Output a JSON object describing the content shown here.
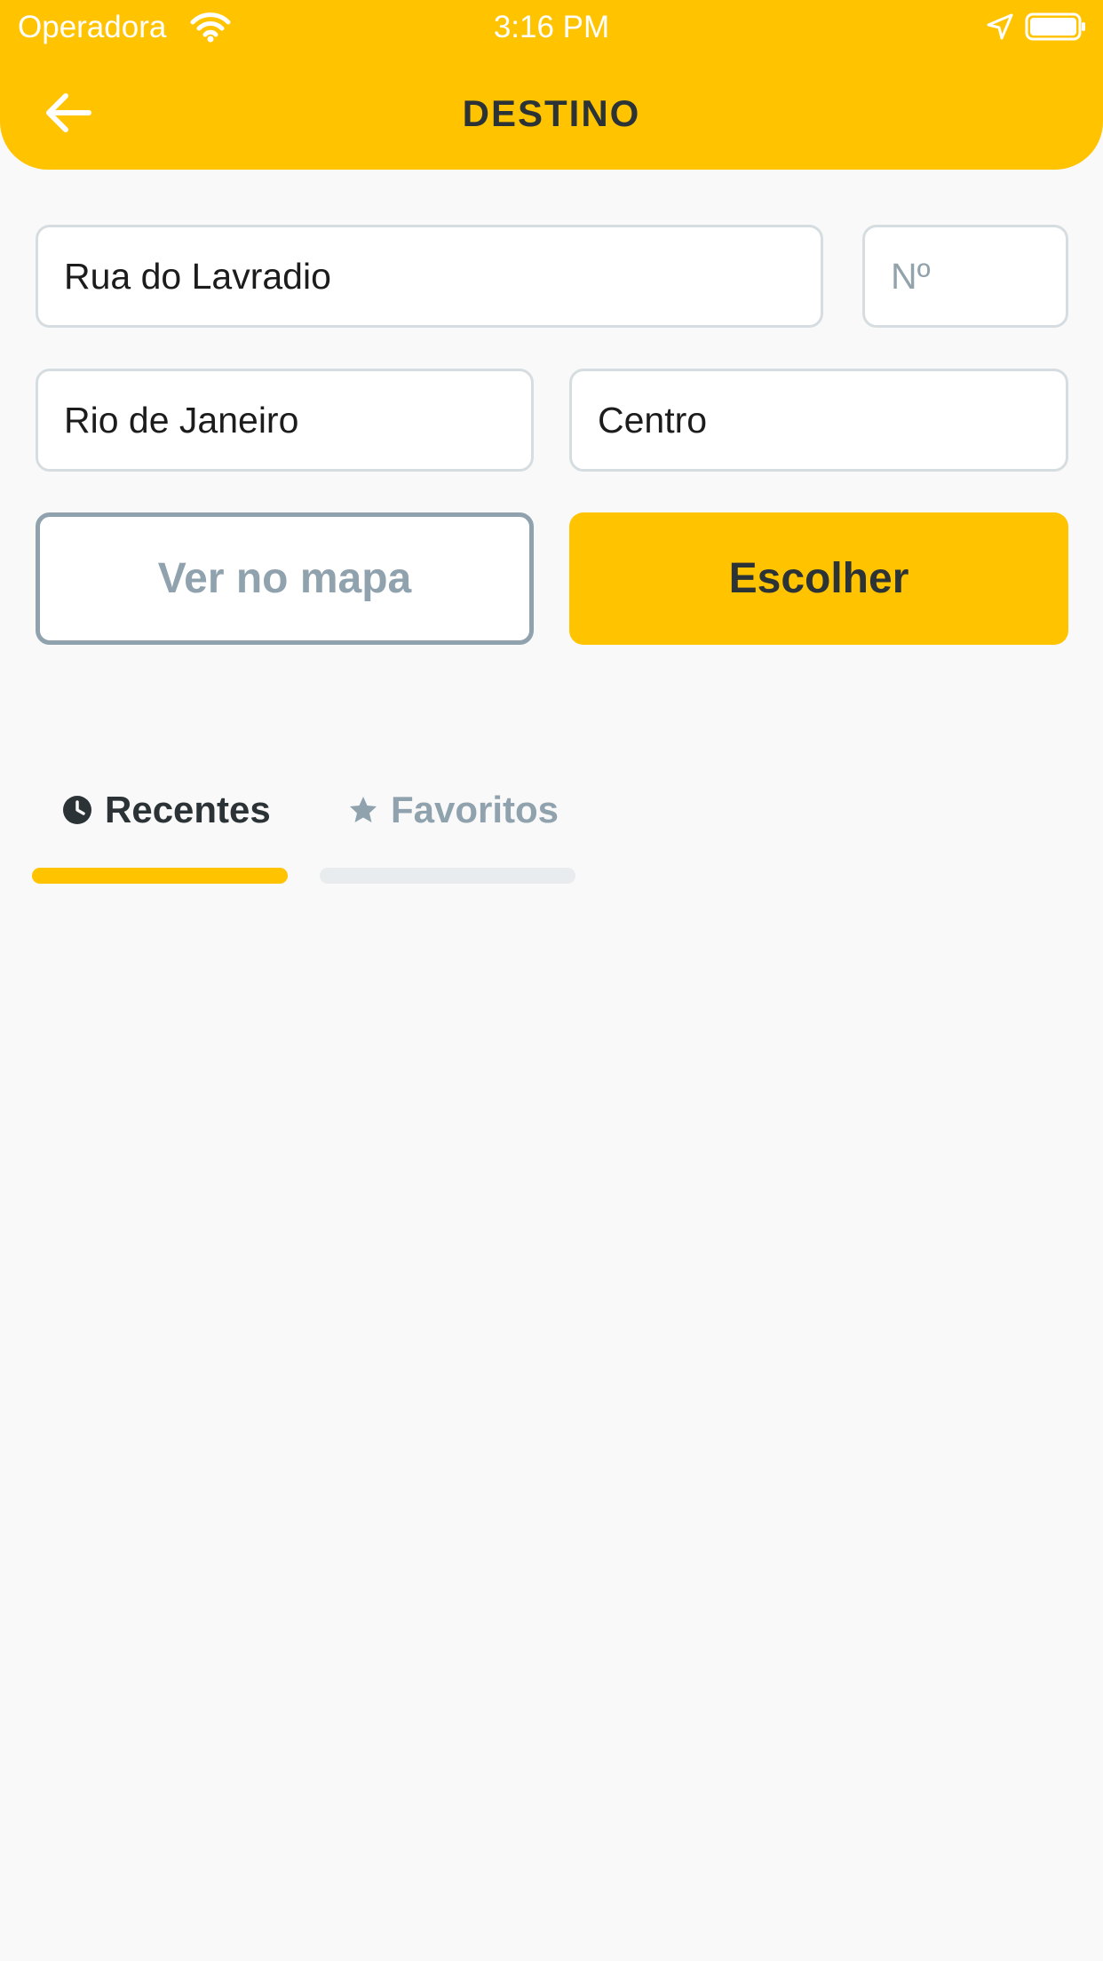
{
  "colors": {
    "accent": "#ffc300",
    "title_text": "#2c3337",
    "muted": "#8fa2ad",
    "field_border": "#d6dde0",
    "background": "#f9f9f9"
  },
  "status_bar": {
    "carrier": "Operadora",
    "time": "3:16 PM"
  },
  "header": {
    "title": "DESTINO",
    "back_icon": "arrow-left-icon"
  },
  "form": {
    "street": {
      "value": "Rua do Lavradio",
      "placeholder": ""
    },
    "number": {
      "value": "",
      "placeholder": "Nº"
    },
    "city": {
      "value": "Rio de Janeiro",
      "placeholder": ""
    },
    "neighborhood": {
      "value": "Centro",
      "placeholder": ""
    }
  },
  "buttons": {
    "map_label": "Ver no mapa",
    "choose_label": "Escolher"
  },
  "tabs": [
    {
      "label": "Recentes",
      "icon": "clock-icon",
      "active": true
    },
    {
      "label": "Favoritos",
      "icon": "star-icon",
      "active": false
    }
  ]
}
